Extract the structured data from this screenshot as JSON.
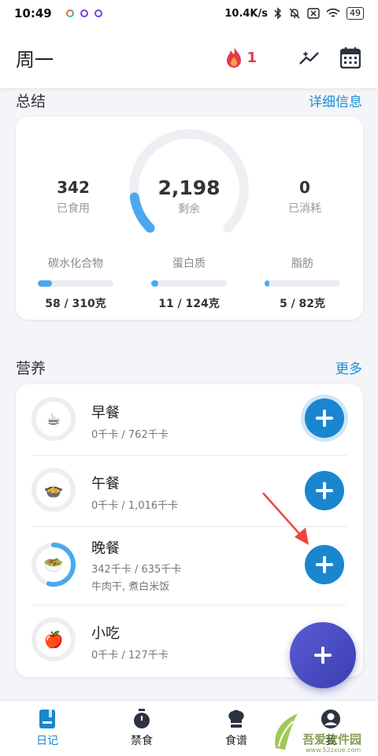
{
  "status_bar": {
    "time": "10:49",
    "speed": "10.4K/s",
    "battery": "49"
  },
  "header": {
    "day": "周一",
    "streak_count": "1",
    "icons": [
      "flame-icon",
      "trend-chart-icon",
      "calendar-icon"
    ]
  },
  "summary": {
    "title": "总结",
    "link": "详细信息",
    "eaten_value": "342",
    "eaten_label": "已食用",
    "remaining_value": "2,198",
    "remaining_label": "剩余",
    "burned_value": "0",
    "burned_label": "已消耗",
    "ring_progress": 0.135,
    "macros": [
      {
        "label": "碳水化合物",
        "value": "58 / 310克",
        "progress": 0.187
      },
      {
        "label": "蛋白质",
        "value": "11 / 124克",
        "progress": 0.089
      },
      {
        "label": "脂肪",
        "value": "5 / 82克",
        "progress": 0.061
      }
    ]
  },
  "nutrition": {
    "title": "营养",
    "link": "更多",
    "meals": [
      {
        "name": "早餐",
        "kcal": "0千卡 / 762千卡",
        "foods": "",
        "icon": "coffee-cup-icon",
        "emoji": "☕",
        "progress": 0
      },
      {
        "name": "午餐",
        "kcal": "0千卡 / 1,016千卡",
        "foods": "",
        "icon": "pot-icon",
        "emoji": "🍲",
        "progress": 0
      },
      {
        "name": "晚餐",
        "kcal": "342千卡 / 635千卡",
        "foods": "牛肉干, 煮白米饭",
        "icon": "salad-icon",
        "emoji": "🥗",
        "progress": 0.539
      },
      {
        "name": "小吃",
        "kcal": "0千卡 / 127千卡",
        "foods": "",
        "icon": "apple-icon",
        "emoji": "🍎",
        "progress": 0
      }
    ]
  },
  "bottom_nav": {
    "items": [
      {
        "label": "日记",
        "icon": "diary-icon",
        "active": true
      },
      {
        "label": "禁食",
        "icon": "stopwatch-icon",
        "active": false
      },
      {
        "label": "食谱",
        "icon": "chef-hat-icon",
        "active": false
      },
      {
        "label": "我",
        "icon": "profile-icon",
        "active": false
      }
    ]
  },
  "watermark": {
    "text": "吾爱软件园",
    "sub": "www.52zxue.com"
  },
  "colors": {
    "accent": "#1a86cf",
    "link": "#1a8fd6",
    "progress": "#4aa8f0",
    "streak": "#e53950",
    "fab": "#4b4dc4"
  }
}
